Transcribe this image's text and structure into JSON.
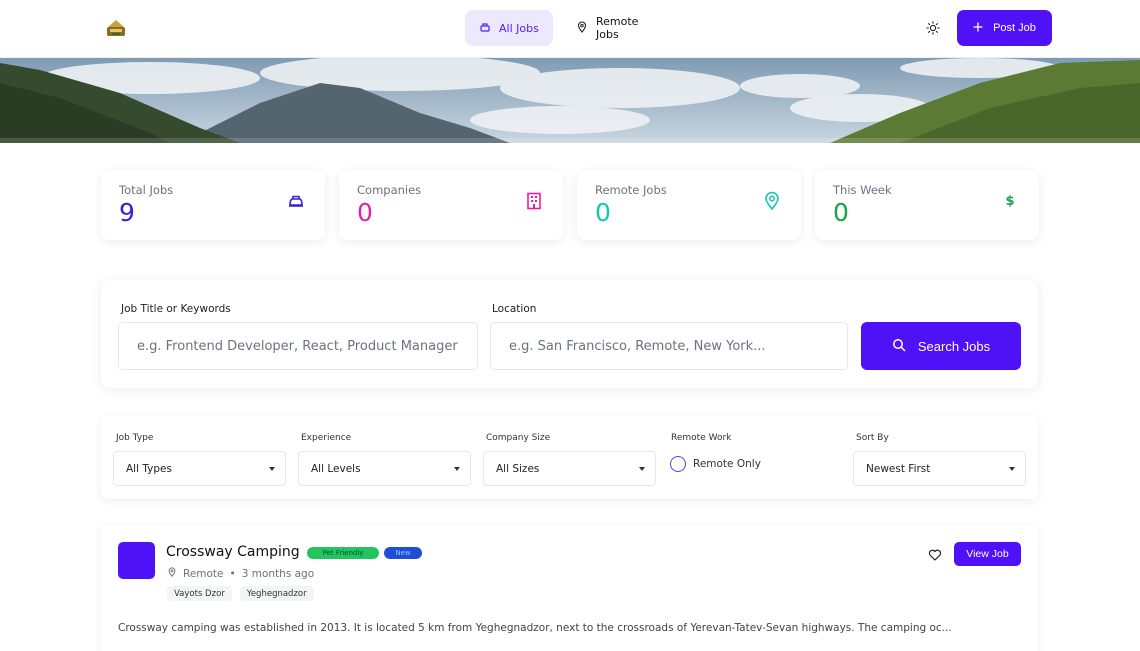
{
  "header": {
    "nav": [
      {
        "label": "All Jobs",
        "icon": "briefcase-icon",
        "active": true
      },
      {
        "label": "Remote Jobs",
        "icon": "map-pin-icon",
        "active": false
      }
    ],
    "theme_icon": "sun-icon",
    "post_job_label": "Post Job",
    "post_job_icon": "plus-icon"
  },
  "stats": [
    {
      "label": "Total Jobs",
      "value": "9",
      "color": "#3b1fd1",
      "icon": "briefcase-icon"
    },
    {
      "label": "Companies",
      "value": "0",
      "color": "#e91ea8",
      "icon": "building-icon"
    },
    {
      "label": "Remote Jobs",
      "value": "0",
      "color": "#14c7b4",
      "icon": "map-pin-icon"
    },
    {
      "label": "This Week",
      "value": "0",
      "color": "#16a34a",
      "icon": "dollar-icon"
    }
  ],
  "search": {
    "keywords_label": "Job Title or Keywords",
    "keywords_placeholder": "e.g. Frontend Developer, React, Product Manager",
    "location_label": "Location",
    "location_placeholder": "e.g. San Francisco, Remote, New York...",
    "button_label": "Search Jobs"
  },
  "filters": {
    "job_type": {
      "label": "Job Type",
      "value": "All Types"
    },
    "experience": {
      "label": "Experience",
      "value": "All Levels"
    },
    "company_size": {
      "label": "Company Size",
      "value": "All Sizes"
    },
    "remote": {
      "label": "Remote Work",
      "option": "Remote Only",
      "checked": false
    },
    "sort": {
      "label": "Sort By",
      "value": "Newest First"
    }
  },
  "jobs": [
    {
      "title": "Crossway Camping",
      "badges": [
        "Pet Friendly",
        "New"
      ],
      "location": "Remote",
      "posted": "3 months ago",
      "tags": [
        "Vayots Dzor",
        "Yeghegnadzor"
      ],
      "view_label": "View Job",
      "description": "Crossway camping was established in 2013. It is located 5 km from Yeghegnadzor, next to the crossroads of Yerevan-Tatev-Sevan highways. The camping oc..."
    }
  ],
  "colors": {
    "accent": "#4f11f5"
  }
}
